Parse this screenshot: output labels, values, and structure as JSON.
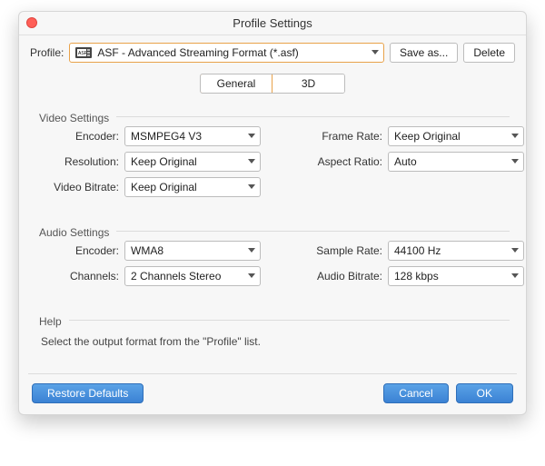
{
  "window": {
    "title": "Profile Settings"
  },
  "toprow": {
    "profile_label": "Profile:",
    "selected_profile": "ASF - Advanced Streaming Format (*.asf)",
    "save_as": "Save as...",
    "delete": "Delete"
  },
  "tabs": {
    "general": "General",
    "threeD": "3D"
  },
  "video": {
    "legend": "Video Settings",
    "encoder_label": "Encoder:",
    "encoder": "MSMPEG4 V3",
    "resolution_label": "Resolution:",
    "resolution": "Keep Original",
    "bitrate_label": "Video Bitrate:",
    "bitrate": "Keep Original",
    "framerate_label": "Frame Rate:",
    "framerate": "Keep Original",
    "aspect_label": "Aspect Ratio:",
    "aspect": "Auto"
  },
  "audio": {
    "legend": "Audio Settings",
    "encoder_label": "Encoder:",
    "encoder": "WMA8",
    "channels_label": "Channels:",
    "channels": "2 Channels Stereo",
    "samplerate_label": "Sample Rate:",
    "samplerate": "44100 Hz",
    "bitrate_label": "Audio Bitrate:",
    "bitrate": "128 kbps"
  },
  "help": {
    "legend": "Help",
    "text": "Select the output format from the \"Profile\" list."
  },
  "footer": {
    "restore": "Restore Defaults",
    "cancel": "Cancel",
    "ok": "OK"
  }
}
